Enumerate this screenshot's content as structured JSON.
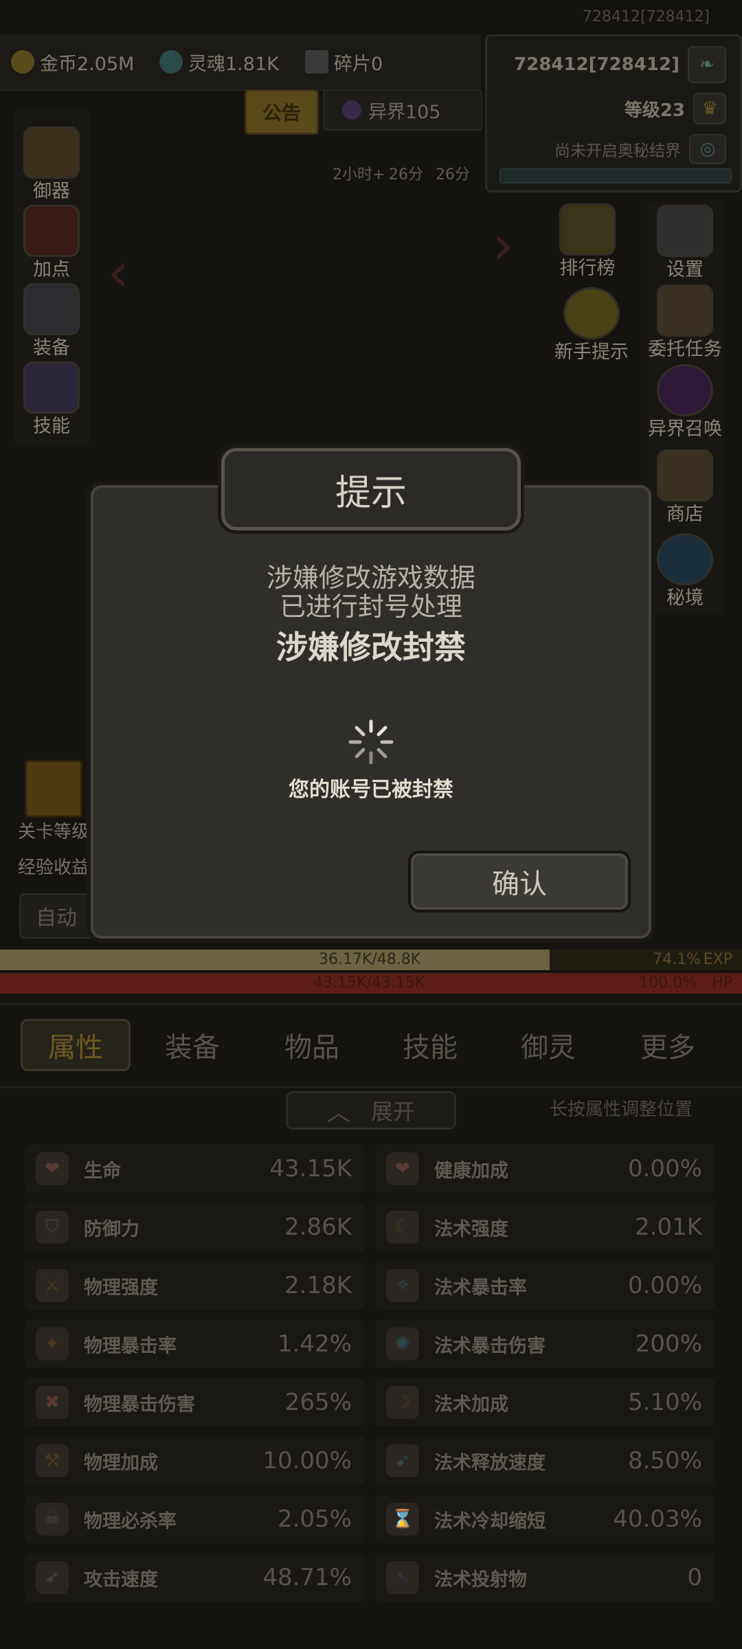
{
  "header": {
    "uid_top": "728412[728412]",
    "gold": "金币2.05M",
    "soul": "灵魂1.81K",
    "shards": "碎片0",
    "player_id": "728412[728412]",
    "level": "等级23",
    "realm_status": "尚未开启奥秘结界",
    "notice": "公告",
    "other_world": "异界105",
    "timers": [
      "2小时+",
      "26分",
      "26分"
    ]
  },
  "left_menu": [
    "御器",
    "加点",
    "装备",
    "技能"
  ],
  "right_menu": [
    "排行榜",
    "新手提示",
    "设置",
    "委托任务",
    "异界召唤",
    "商店",
    "秘境"
  ],
  "stage": {
    "level_label": "关卡等级",
    "exp_gain_label": "经验收益",
    "auto_label": "自动"
  },
  "bars": {
    "exp_text": "36.17K/48.8K",
    "exp_pct": "74.1%",
    "exp_label": "EXP",
    "exp_fill": 0.741,
    "hp_text": "43.15K/43.15K",
    "hp_pct": "100.0%",
    "hp_label": "HP",
    "hp_fill": 1.0
  },
  "tabs": [
    "属性",
    "装备",
    "物品",
    "技能",
    "御灵",
    "更多"
  ],
  "expand_label": "展开",
  "long_press_hint": "长按属性调整位置",
  "stats_left": [
    {
      "name": "生命",
      "value": "43.15K"
    },
    {
      "name": "防御力",
      "value": "2.86K"
    },
    {
      "name": "物理强度",
      "value": "2.18K"
    },
    {
      "name": "物理暴击率",
      "value": "1.42%"
    },
    {
      "name": "物理暴击伤害",
      "value": "265%"
    },
    {
      "name": "物理加成",
      "value": "10.00%"
    },
    {
      "name": "物理必杀率",
      "value": "2.05%"
    },
    {
      "name": "攻击速度",
      "value": "48.71%"
    }
  ],
  "stats_right": [
    {
      "name": "健康加成",
      "value": "0.00%"
    },
    {
      "name": "法术强度",
      "value": "2.01K"
    },
    {
      "name": "法术暴击率",
      "value": "0.00%"
    },
    {
      "name": "法术暴击伤害",
      "value": "200%"
    },
    {
      "name": "法术加成",
      "value": "5.10%"
    },
    {
      "name": "法术释放速度",
      "value": "8.50%"
    },
    {
      "name": "法术冷却缩短",
      "value": "40.03%"
    },
    {
      "name": "法术投射物",
      "value": "0"
    }
  ],
  "dialog": {
    "title": "提示",
    "line1": "涉嫌修改游戏数据",
    "line2": "已进行封号处理",
    "headline": "涉嫌修改封禁",
    "loading_text": "您的账号已被封禁",
    "confirm": "确认"
  },
  "colors": {
    "exp_bar": "#6b6341",
    "hp_bar": "#5c1d1a",
    "dialog_bg": "#302e2a",
    "accent_gold": "#6d5a21"
  }
}
